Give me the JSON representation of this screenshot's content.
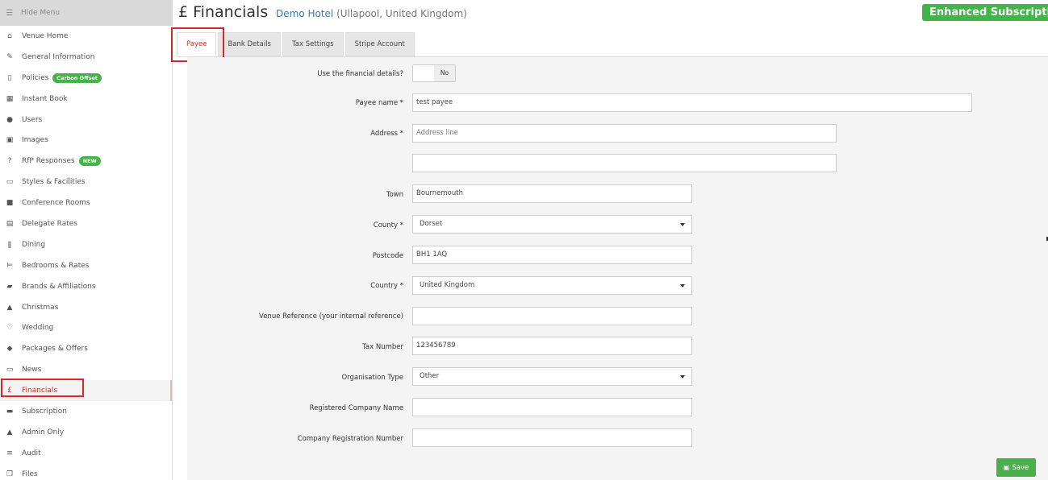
{
  "sidebar": {
    "hide_menu": {
      "label": "Hide Menu",
      "icon": "hamburger-icon"
    },
    "items": [
      {
        "label": "Venue Home",
        "icon": "home-icon"
      },
      {
        "label": "General Information",
        "icon": "edit-icon"
      },
      {
        "label": "Policies",
        "icon": "document-icon",
        "badge": "Carbon Offset"
      },
      {
        "label": "Instant Book",
        "icon": "calendar-icon"
      },
      {
        "label": "Users",
        "icon": "user-icon"
      },
      {
        "label": "Images",
        "icon": "image-icon"
      },
      {
        "label": "RfP Responses",
        "icon": "question-icon",
        "badge": "NEW"
      },
      {
        "label": "Styles & Facilities",
        "icon": "monitor-icon"
      },
      {
        "label": "Conference Rooms",
        "icon": "briefcase-icon"
      },
      {
        "label": "Delegate Rates",
        "icon": "calculator-icon"
      },
      {
        "label": "Dining",
        "icon": "cutlery-icon"
      },
      {
        "label": "Bedrooms & Rates",
        "icon": "bed-icon"
      },
      {
        "label": "Brands & Affiliations",
        "icon": "book-icon"
      },
      {
        "label": "Christmas",
        "icon": "tree-icon"
      },
      {
        "label": "Wedding",
        "icon": "heart-icon"
      },
      {
        "label": "Packages & Offers",
        "icon": "tag-icon"
      },
      {
        "label": "News",
        "icon": "newspaper-icon"
      },
      {
        "label": "Financials",
        "icon": "pound-icon",
        "active": true
      },
      {
        "label": "Subscription",
        "icon": "credit-card-icon"
      },
      {
        "label": "Admin Only",
        "icon": "warning-icon"
      },
      {
        "label": "Audit",
        "icon": "list-icon"
      },
      {
        "label": "Files",
        "icon": "files-icon"
      }
    ]
  },
  "header": {
    "title": "£ Financials",
    "hotel_name": "Demo Hotel",
    "location": "(Ullapool, United Kingdom)",
    "subscription_button": "Enhanced Subscription"
  },
  "tabs": [
    {
      "label": "Payee",
      "active": true
    },
    {
      "label": "Bank Details"
    },
    {
      "label": "Tax Settings"
    },
    {
      "label": "Stripe Account"
    }
  ],
  "form": {
    "use_financial": {
      "label": "Use the financial details?",
      "value": "No"
    },
    "payee_name": {
      "label": "Payee name *",
      "value": "test payee"
    },
    "address": {
      "label": "Address *",
      "placeholder": "Address line",
      "line2": ""
    },
    "town": {
      "label": "Town",
      "value": "Bournemouth"
    },
    "county": {
      "label": "County *",
      "value": "Dorset"
    },
    "postcode": {
      "label": "Postcode",
      "value": "BH1 1AQ"
    },
    "country": {
      "label": "Country *",
      "value": "United Kingdom"
    },
    "venue_reference": {
      "label": "Venue Reference (your internal reference)",
      "value": ""
    },
    "tax_number": {
      "label": "Tax Number",
      "value": "123456789"
    },
    "organisation_type": {
      "label": "Organisation Type",
      "value": "Other"
    },
    "registered_company_name": {
      "label": "Registered Company Name",
      "value": ""
    },
    "company_registration_number": {
      "label": "Company Registration Number",
      "value": ""
    }
  },
  "actions": {
    "save_label": "Save",
    "save_icon": "floppy-icon"
  },
  "colors": {
    "accent_green": "#43b548",
    "active_red": "#c0392b",
    "highlight_red": "#d9262c",
    "link_blue": "#3a78b5"
  }
}
